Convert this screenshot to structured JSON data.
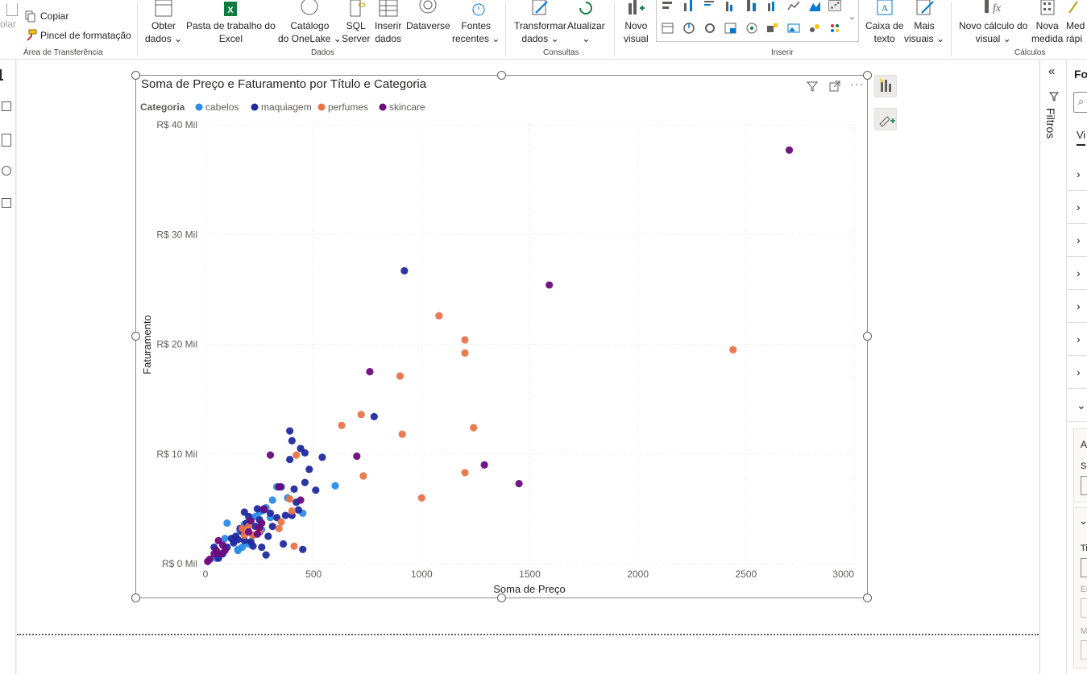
{
  "ribbon": {
    "clipboard": {
      "paste_label": "olar",
      "copy_label": "Copiar",
      "format_painter_label": "Pincel de formatação",
      "group_label": "Área de Transferência"
    },
    "data": {
      "get_data": [
        "Obter",
        "dados"
      ],
      "excel": [
        "Pasta de trabalho do",
        "Excel"
      ],
      "onelake": [
        "Catálogo",
        "do OneLake"
      ],
      "sql": [
        "SQL",
        "Server"
      ],
      "enter_data": [
        "Inserir",
        "dados"
      ],
      "dataverse": "Dataverse",
      "recent_sources": [
        "Fontes",
        "recentes"
      ],
      "group_label": "Dados"
    },
    "queries": {
      "transform": [
        "Transformar",
        "dados"
      ],
      "refresh": "Atualizar",
      "group_label": "Consultas"
    },
    "insert": {
      "new_visual": [
        "Novo",
        "visual"
      ],
      "text_box": [
        "Caixa de",
        "texto"
      ],
      "more_visuals": [
        "Mais",
        "visuais"
      ],
      "group_label": "Inserir"
    },
    "calculations": {
      "new_visual_calc": [
        "Novo cálculo do",
        "visual"
      ],
      "new_measure": [
        "Nova",
        "medida"
      ],
      "quick_measure": [
        "Med",
        "rápi"
      ],
      "group_label": "Cálculos"
    }
  },
  "filters_pane": {
    "label": "Filtros"
  },
  "format_pane": {
    "title": "Fo",
    "tab": "Vi",
    "sub1": "A",
    "sub2": "Se",
    "sub3": "Ti",
    "sub4": "Es",
    "sub5": "M"
  },
  "colors": {
    "cabelos": "#2a8ce8",
    "maquiagem": "#212a9f",
    "perfumes": "#e8744a",
    "skincare": "#6b087e"
  },
  "chart_data": {
    "type": "scatter",
    "title": "Soma de Preço e Faturamento por Título e Categoria",
    "legend_title": "Categoria",
    "legend_position": "top-left",
    "xlabel": "Soma de Preço",
    "ylabel": "Faturamento",
    "xlim": [
      0,
      3000
    ],
    "ylim": [
      0,
      40000
    ],
    "x_ticks": [
      "0",
      "500",
      "1000",
      "1500",
      "2000",
      "2500",
      "3000"
    ],
    "y_ticks": [
      "R$ 0 Mil",
      "R$ 10 Mil",
      "R$ 20 Mil",
      "R$ 30 Mil",
      "R$ 40 Mil"
    ],
    "grid": true,
    "series": [
      {
        "name": "cabelos",
        "points": [
          [
            50,
            500
          ],
          [
            90,
            2300
          ],
          [
            100,
            3700
          ],
          [
            130,
            2100
          ],
          [
            150,
            1200
          ],
          [
            160,
            3000
          ],
          [
            170,
            1500
          ],
          [
            180,
            3600
          ],
          [
            200,
            1800
          ],
          [
            230,
            4300
          ],
          [
            250,
            4700
          ],
          [
            260,
            3100
          ],
          [
            280,
            5100
          ],
          [
            300,
            4200
          ],
          [
            310,
            5800
          ],
          [
            330,
            7000
          ],
          [
            380,
            6000
          ],
          [
            450,
            4600
          ],
          [
            600,
            7100
          ],
          [
            150,
            1300
          ]
        ]
      },
      {
        "name": "maquiagem",
        "points": [
          [
            40,
            1500
          ],
          [
            60,
            500
          ],
          [
            80,
            900
          ],
          [
            100,
            1500
          ],
          [
            120,
            2300
          ],
          [
            130,
            1900
          ],
          [
            140,
            2500
          ],
          [
            150,
            2200
          ],
          [
            160,
            3200
          ],
          [
            170,
            2900
          ],
          [
            180,
            4700
          ],
          [
            190,
            3700
          ],
          [
            200,
            4300
          ],
          [
            210,
            2000
          ],
          [
            220,
            2600
          ],
          [
            230,
            3400
          ],
          [
            240,
            5000
          ],
          [
            250,
            4000
          ],
          [
            260,
            1500
          ],
          [
            270,
            4900
          ],
          [
            280,
            800
          ],
          [
            290,
            2500
          ],
          [
            300,
            4600
          ],
          [
            310,
            3400
          ],
          [
            330,
            4200
          ],
          [
            350,
            7000
          ],
          [
            360,
            1800
          ],
          [
            370,
            4400
          ],
          [
            390,
            9500
          ],
          [
            390,
            12100
          ],
          [
            400,
            11200
          ],
          [
            410,
            6800
          ],
          [
            420,
            5600
          ],
          [
            430,
            4900
          ],
          [
            440,
            10500
          ],
          [
            450,
            1300
          ],
          [
            460,
            7400
          ],
          [
            460,
            10100
          ],
          [
            480,
            8600
          ],
          [
            510,
            6700
          ],
          [
            540,
            9700
          ],
          [
            400,
            4400
          ],
          [
            920,
            26700
          ],
          [
            780,
            13400
          ],
          [
            250,
            2900
          ],
          [
            180,
            2100
          ],
          [
            220,
            1600
          ]
        ]
      },
      {
        "name": "perfumes",
        "points": [
          [
            170,
            3200
          ],
          [
            180,
            2600
          ],
          [
            200,
            3400
          ],
          [
            220,
            2600
          ],
          [
            250,
            3000
          ],
          [
            340,
            3200
          ],
          [
            350,
            3800
          ],
          [
            390,
            5900
          ],
          [
            400,
            4800
          ],
          [
            410,
            1600
          ],
          [
            420,
            9900
          ],
          [
            630,
            12600
          ],
          [
            720,
            13600
          ],
          [
            730,
            8000
          ],
          [
            900,
            17100
          ],
          [
            910,
            11800
          ],
          [
            1000,
            6000
          ],
          [
            1080,
            22600
          ],
          [
            1200,
            20400
          ],
          [
            1200,
            19200
          ],
          [
            1200,
            8300
          ],
          [
            1240,
            12400
          ],
          [
            2440,
            19500
          ]
        ]
      },
      {
        "name": "skincare",
        "points": [
          [
            10,
            200
          ],
          [
            20,
            400
          ],
          [
            40,
            900
          ],
          [
            50,
            1200
          ],
          [
            60,
            2100
          ],
          [
            70,
            900
          ],
          [
            80,
            1700
          ],
          [
            90,
            1200
          ],
          [
            200,
            2900
          ],
          [
            210,
            3900
          ],
          [
            240,
            2700
          ],
          [
            250,
            3300
          ],
          [
            260,
            3700
          ],
          [
            300,
            9900
          ],
          [
            340,
            7000
          ],
          [
            440,
            5800
          ],
          [
            700,
            9800
          ],
          [
            760,
            17500
          ],
          [
            1290,
            9000
          ],
          [
            1450,
            7300
          ],
          [
            1590,
            25400
          ],
          [
            2700,
            37700
          ],
          [
            270,
            5000
          ]
        ]
      }
    ]
  }
}
